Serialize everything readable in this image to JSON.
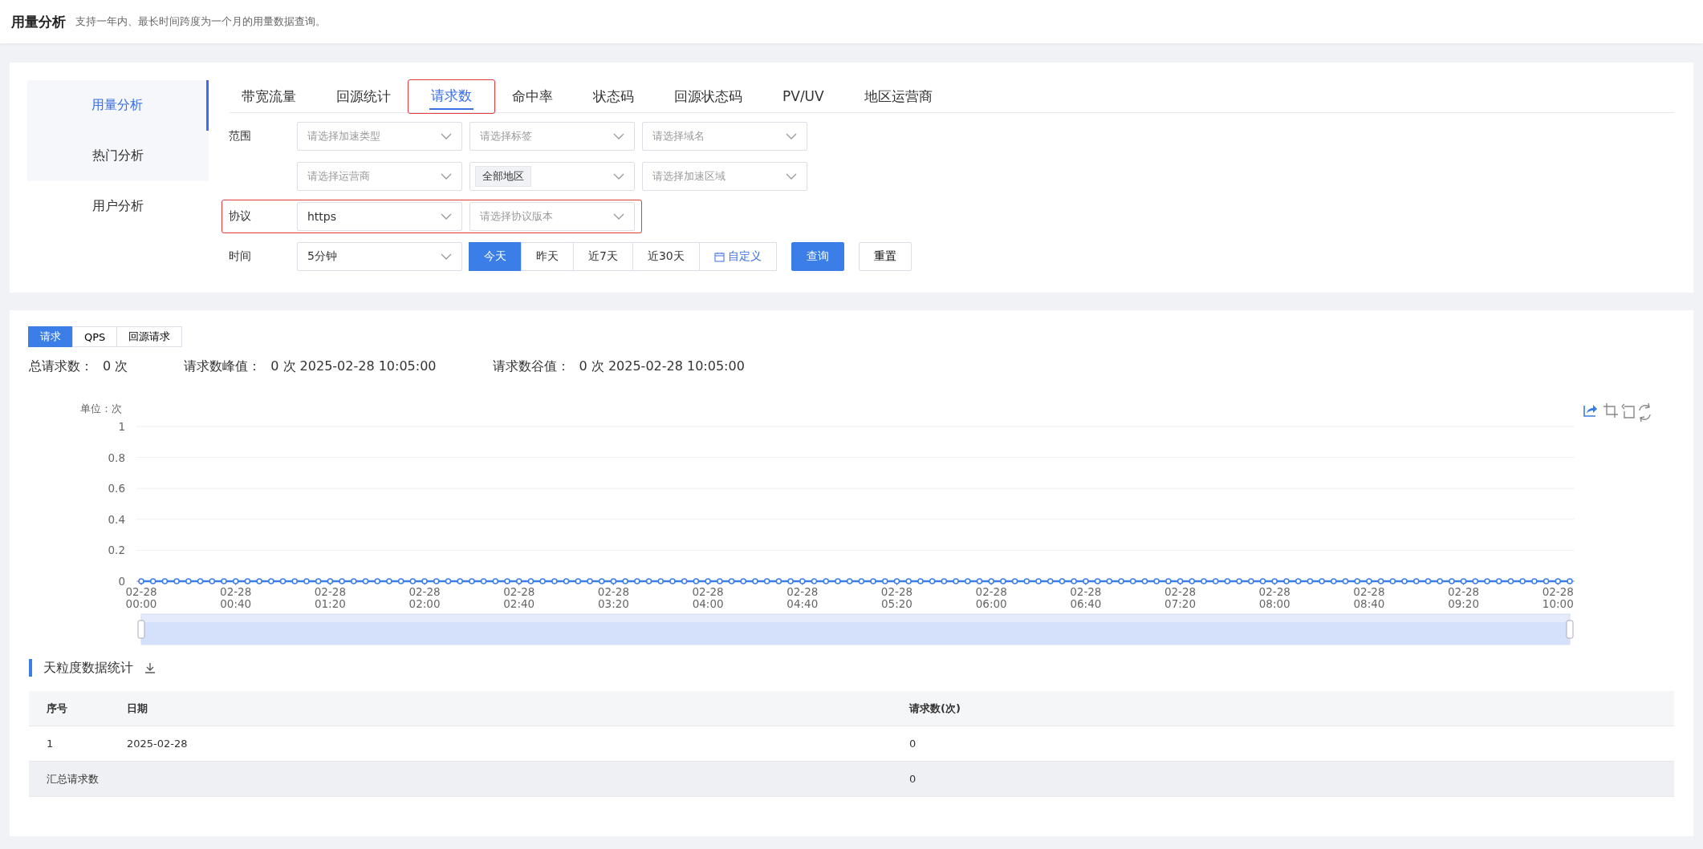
{
  "header": {
    "title": "用量分析",
    "subtitle": "支持一年内、最长时间跨度为一个月的用量数据查询。"
  },
  "sidebar": {
    "items": [
      {
        "label": "用量分析",
        "selected": true
      },
      {
        "label": "热门分析",
        "selected": false
      },
      {
        "label": "用户分析",
        "selected": false
      }
    ]
  },
  "tabs": [
    {
      "label": "带宽流量",
      "selected": false,
      "highlighted": false
    },
    {
      "label": "回源统计",
      "selected": false,
      "highlighted": false
    },
    {
      "label": "请求数",
      "selected": true,
      "highlighted": true
    },
    {
      "label": "命中率",
      "selected": false,
      "highlighted": false
    },
    {
      "label": "状态码",
      "selected": false,
      "highlighted": false
    },
    {
      "label": "回源状态码",
      "selected": false,
      "highlighted": false
    },
    {
      "label": "PV/UV",
      "selected": false,
      "highlighted": false
    },
    {
      "label": "地区运营商",
      "selected": false,
      "highlighted": false
    }
  ],
  "filters": [
    {
      "label": "范围",
      "highlighted": false,
      "fields": [
        {
          "placeholder": "请选择加速类型"
        },
        {
          "placeholder": "请选择标签"
        },
        {
          "placeholder": "请选择域名"
        }
      ]
    },
    {
      "highlighted": false,
      "fields": [
        {
          "placeholder": "请选择运营商"
        },
        {
          "tag": "全部地区"
        },
        {
          "placeholder": "请选择加速区域"
        }
      ]
    },
    {
      "label": "协议",
      "highlighted": true,
      "fields": [
        {
          "value": "https"
        },
        {
          "placeholder": "请选择协议版本"
        }
      ]
    },
    {
      "label": "时间",
      "highlighted": false,
      "fields": [
        {
          "value": "5分钟"
        }
      ]
    }
  ],
  "time_range": [
    {
      "label": "今天",
      "selected": true,
      "kind": "preset"
    },
    {
      "label": "昨天",
      "selected": false,
      "kind": "preset"
    },
    {
      "label": "近7天",
      "selected": false,
      "kind": "preset"
    },
    {
      "label": "近30天",
      "selected": false,
      "kind": "preset"
    },
    {
      "label": "自定义",
      "selected": false,
      "kind": "custom"
    }
  ],
  "buttons": {
    "query": "查询",
    "reset": "重置"
  },
  "metric_tabs": [
    {
      "label": "请求",
      "selected": true
    },
    {
      "label": "QPS",
      "selected": false
    },
    {
      "label": "回源请求",
      "selected": false
    }
  ],
  "stats": [
    {
      "label": "总请求数：",
      "value": "0 次"
    },
    {
      "label": "请求数峰值：",
      "value": "0 次 2025-02-28 10:05:00"
    },
    {
      "label": "请求数谷值：",
      "value": "0 次 2025-02-28 10:05:00"
    }
  ],
  "chart": {
    "chart_data": {
      "type": "line",
      "ylabel": "单位：次",
      "ylim": [
        0,
        1
      ],
      "yticks": [
        0,
        0.2,
        0.4,
        0.6,
        0.8,
        1
      ],
      "grid": true,
      "categories": [
        "02-28 00:00",
        null,
        null,
        null,
        null,
        null,
        null,
        null,
        "02-28 00:40",
        null,
        null,
        null,
        null,
        null,
        null,
        null,
        "02-28 01:20",
        null,
        null,
        null,
        null,
        null,
        null,
        null,
        "02-28 02:00",
        null,
        null,
        null,
        null,
        null,
        null,
        null,
        "02-28 02:40",
        null,
        null,
        null,
        null,
        null,
        null,
        null,
        "02-28 03:20",
        null,
        null,
        null,
        null,
        null,
        null,
        null,
        "02-28 04:00",
        null,
        null,
        null,
        null,
        null,
        null,
        null,
        "02-28 04:40",
        null,
        null,
        null,
        null,
        null,
        null,
        null,
        "02-28 05:20",
        null,
        null,
        null,
        null,
        null,
        null,
        null,
        "02-28 06:00",
        null,
        null,
        null,
        null,
        null,
        null,
        null,
        "02-28 06:40",
        null,
        null,
        null,
        null,
        null,
        null,
        null,
        "02-28 07:20",
        null,
        null,
        null,
        null,
        null,
        null,
        null,
        "02-28 08:00",
        null,
        null,
        null,
        null,
        null,
        null,
        null,
        "02-28 08:40",
        null,
        null,
        null,
        null,
        null,
        null,
        null,
        "02-28 09:20",
        null,
        null,
        null,
        null,
        null,
        null,
        null,
        "02-28 10:00",
        null
      ],
      "series": [
        {
          "color": "#3b7ee8",
          "marker": "circle",
          "values": [
            0,
            0,
            0,
            0,
            0,
            0,
            0,
            0,
            0,
            0,
            0,
            0,
            0,
            0,
            0,
            0,
            0,
            0,
            0,
            0,
            0,
            0,
            0,
            0,
            0,
            0,
            0,
            0,
            0,
            0,
            0,
            0,
            0,
            0,
            0,
            0,
            0,
            0,
            0,
            0,
            0,
            0,
            0,
            0,
            0,
            0,
            0,
            0,
            0,
            0,
            0,
            0,
            0,
            0,
            0,
            0,
            0,
            0,
            0,
            0,
            0,
            0,
            0,
            0,
            0,
            0,
            0,
            0,
            0,
            0,
            0,
            0,
            0,
            0,
            0,
            0,
            0,
            0,
            0,
            0,
            0,
            0,
            0,
            0,
            0,
            0,
            0,
            0,
            0,
            0,
            0,
            0,
            0,
            0,
            0,
            0,
            0,
            0,
            0,
            0,
            0,
            0,
            0,
            0,
            0,
            0,
            0,
            0,
            0,
            0,
            0,
            0,
            0,
            0,
            0,
            0,
            0,
            0,
            0,
            0,
            0,
            0
          ]
        }
      ]
    }
  },
  "daily": {
    "title": "天粒度数据统计",
    "columns": [
      "序号",
      "日期",
      "请求数(次)"
    ],
    "rows": [
      [
        "1",
        "2025-02-28",
        "0"
      ]
    ],
    "summary": {
      "label": "汇总请求数",
      "value": "0"
    }
  }
}
